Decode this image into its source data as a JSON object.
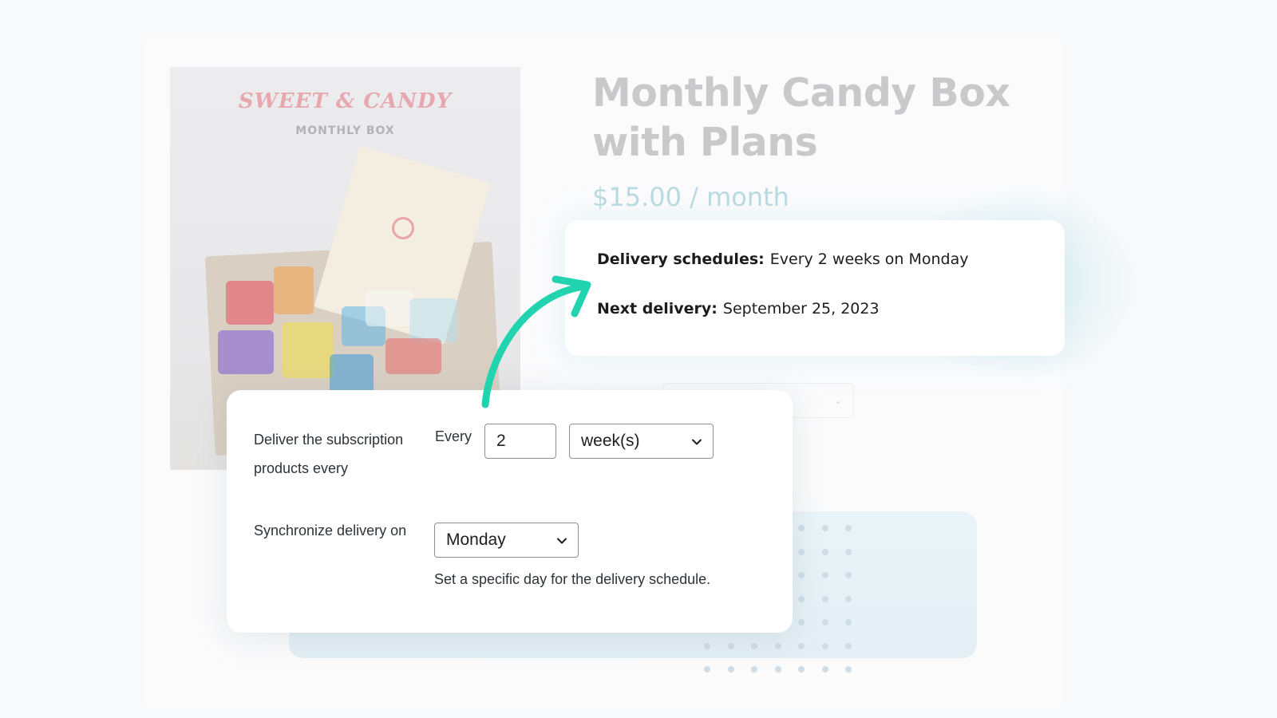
{
  "product": {
    "brand_logo": "SWEET & CANDY",
    "brand_sub": "MONTHLY BOX",
    "title_line1": "Monthly Candy Box",
    "title_line2": "with Plans",
    "price": "$15.00 / month"
  },
  "delivery_info": {
    "schedule_label": "Delivery schedules:",
    "schedule_value": "Every 2 weeks on Monday",
    "next_label": "Next delivery:",
    "next_value": "September 25, 2023"
  },
  "settings": {
    "deliver_label_line1": "Deliver the subscription",
    "deliver_label_line2": "products every",
    "every_label": "Every",
    "interval_value": "2",
    "period_selected": "week(s)",
    "sync_label": "Synchronize delivery on",
    "sync_day_selected": "Monday",
    "sync_help": "Set a specific day for the delivery schedule."
  },
  "colors": {
    "accent_arrow": "#22d3b0",
    "price_faded": "#b9dbe0",
    "title_faded": "#c9c9cb"
  },
  "icons": {
    "select_chevron": "chevron-down-icon",
    "connector": "curved-arrow-icon"
  }
}
